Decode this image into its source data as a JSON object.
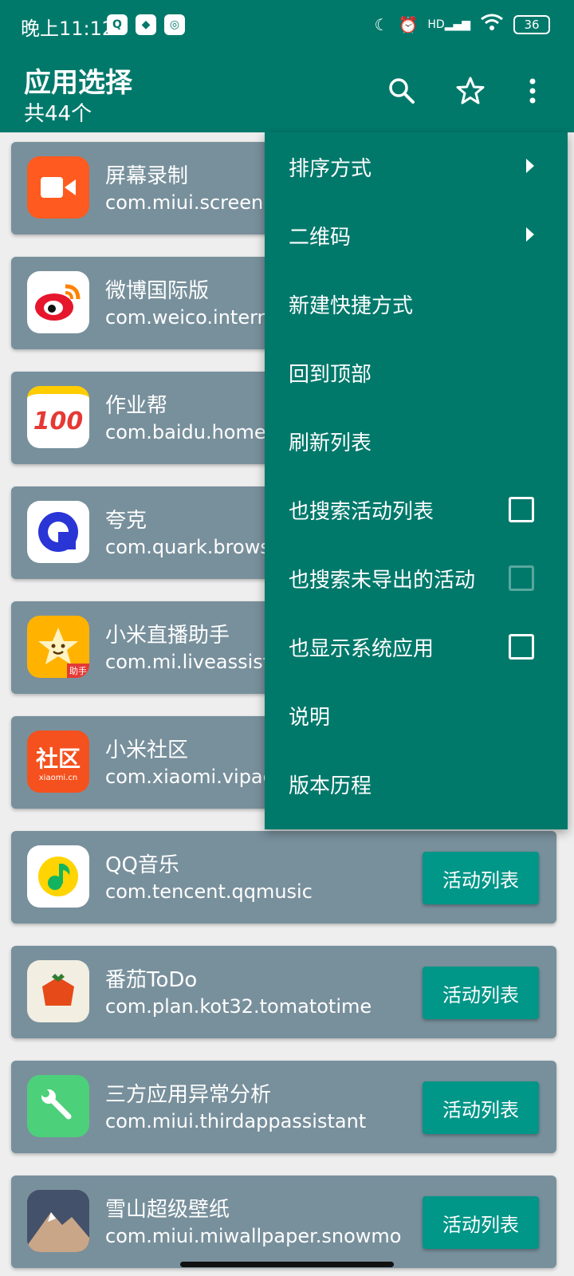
{
  "status": {
    "time": "晚上11:12",
    "battery": "36",
    "hd": "HD"
  },
  "app_bar": {
    "title": "应用选择",
    "subtitle": "共44个"
  },
  "menu": {
    "items": [
      {
        "label": "排序方式",
        "type": "submenu"
      },
      {
        "label": "二维码",
        "type": "submenu"
      },
      {
        "label": "新建快捷方式",
        "type": "action"
      },
      {
        "label": "回到顶部",
        "type": "action"
      },
      {
        "label": "刷新列表",
        "type": "action"
      },
      {
        "label": "也搜索活动列表",
        "type": "checkbox",
        "checked": false
      },
      {
        "label": "也搜索未导出的活动",
        "type": "checkbox",
        "checked": false,
        "disabled": true
      },
      {
        "label": "也显示系统应用",
        "type": "checkbox",
        "checked": false
      },
      {
        "label": "说明",
        "type": "action"
      },
      {
        "label": "版本历程",
        "type": "action"
      }
    ]
  },
  "apps": [
    {
      "name": "屏幕录制",
      "package": "com.miui.screenr",
      "icon": "screen-record-icon",
      "color": "#ff5a1f"
    },
    {
      "name": "微博国际版",
      "package": "com.weico.intern",
      "icon": "weibo-icon",
      "color": "#ffffff"
    },
    {
      "name": "作业帮",
      "package": "com.baidu.home",
      "icon": "zuoyebang-icon",
      "color": "#ffffff",
      "icon_text": "100"
    },
    {
      "name": "夸克",
      "package": "com.quark.brows",
      "icon": "quark-icon",
      "color": "#ffffff"
    },
    {
      "name": "小米直播助手",
      "package": "com.mi.liveassist",
      "icon": "live-assistant-icon",
      "color": "#ffb300",
      "icon_text": "助手"
    },
    {
      "name": "小米社区",
      "package": "com.xiaomi.vipac",
      "icon": "xiaomi-community-icon",
      "color": "#f4511e",
      "icon_text": "社区",
      "icon_subtext": "xiaomi.cn"
    },
    {
      "name": "QQ音乐",
      "package": "com.tencent.qqmusic",
      "icon": "qqmusic-icon",
      "color": "#ffffff",
      "button": "活动列表"
    },
    {
      "name": "番茄ToDo",
      "package": "com.plan.kot32.tomatotime",
      "icon": "tomato-icon",
      "color": "#f2eee2",
      "button": "活动列表"
    },
    {
      "name": "三方应用异常分析",
      "package": "com.miui.thirdappassistant",
      "icon": "wrench-icon",
      "color": "#4cd07a",
      "button": "活动列表"
    },
    {
      "name": "雪山超级壁纸",
      "package": "com.miui.miwallpaper.snowmo",
      "icon": "snow-mountain-icon",
      "color": "#5c6b80",
      "button": "活动列表"
    }
  ]
}
